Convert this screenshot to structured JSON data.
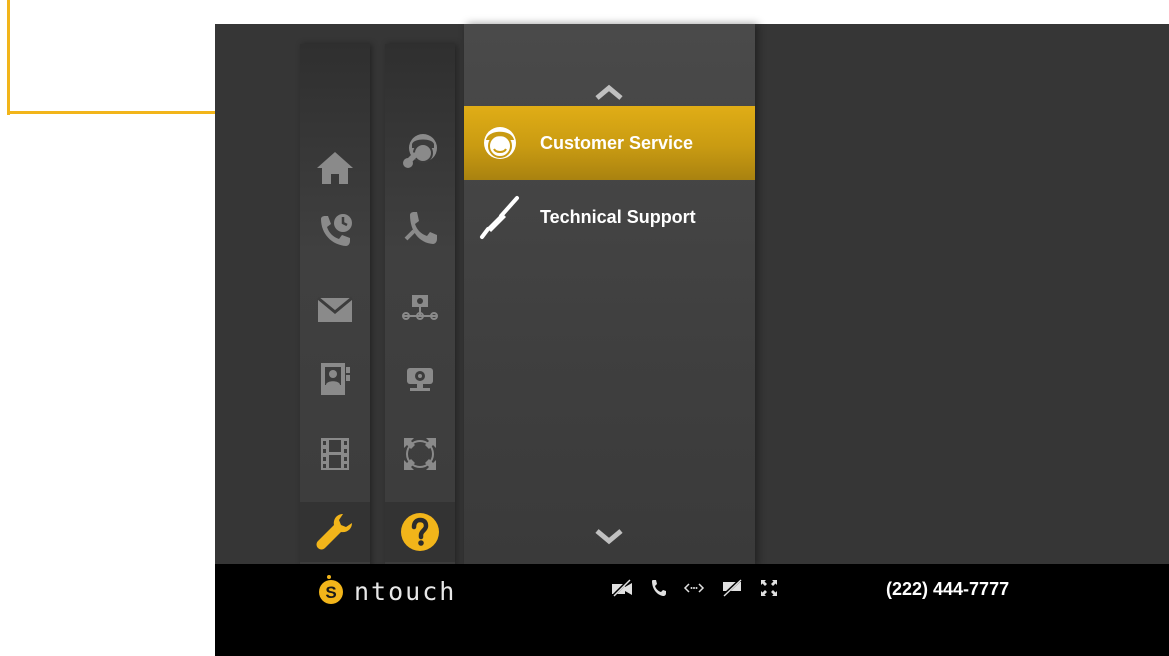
{
  "submenu": {
    "items": [
      {
        "label": "Customer Service",
        "icon": "customer-service-icon",
        "selected": true
      },
      {
        "label": "Technical Support",
        "icon": "screwdriver-icon",
        "selected": false
      }
    ]
  },
  "main_nav": {
    "icons": [
      "home-icon",
      "call-history-icon",
      "mail-icon",
      "contacts-icon",
      "video-library-icon",
      "settings-icon"
    ],
    "active": "settings-icon"
  },
  "sub_nav": {
    "icons": [
      "customer-service-icon",
      "phone-icon",
      "network-icon",
      "webcam-icon",
      "fullscreen-icon",
      "help-icon"
    ],
    "active": "help-icon"
  },
  "status_bar": {
    "brand": "ntouch",
    "brand_logo_letter": "S",
    "icons": [
      "video-off-icon",
      "phone-icon",
      "remote-icon",
      "chat-off-icon",
      "fullscreen-icon"
    ],
    "phone_number": "(222) 444-7777"
  },
  "colors": {
    "accent": "#f2b51a",
    "selected_item": "#c99b12",
    "background": "#363636",
    "status_bar": "#000000",
    "icon_gray": "#8a8a8a"
  }
}
